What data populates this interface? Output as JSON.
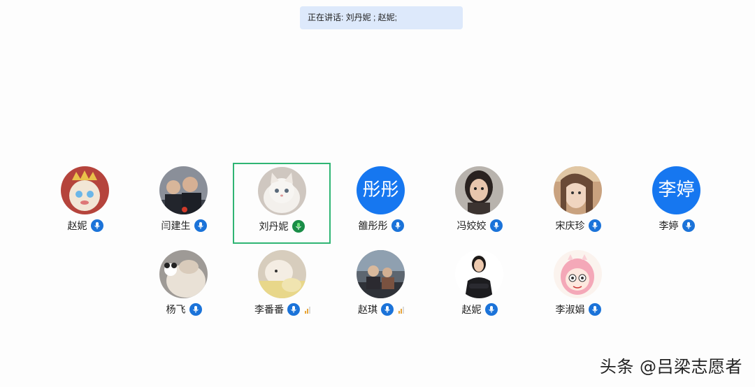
{
  "speaking_bar": {
    "text": "正在讲话: 刘丹妮 ; 赵妮;"
  },
  "participants": [
    {
      "name": "赵妮",
      "avatar": "cat-crown-cartoon",
      "mic_color": "#1b73d9"
    },
    {
      "name": "闫建生",
      "avatar": "men-photo",
      "mic_color": "#1b73d9"
    },
    {
      "name": "刘丹妮",
      "avatar": "white-kitten-photo",
      "mic_color": "#1a8d47",
      "selected": true
    },
    {
      "name": "雒彤彤",
      "avatar_text": "彤彤",
      "mic_color": "#1b73d9"
    },
    {
      "name": "冯姣姣",
      "avatar": "woman-photo",
      "mic_color": "#1b73d9"
    },
    {
      "name": "宋庆珍",
      "avatar": "girl-filter-photo",
      "mic_color": "#1b73d9"
    },
    {
      "name": "李婷",
      "avatar_text": "李婷",
      "mic_color": "#1b73d9"
    },
    {
      "name": "杨飞",
      "avatar": "panda-pillow-photo",
      "mic_color": "#1b73d9"
    },
    {
      "name": "李番番",
      "avatar": "plush-toy-photo",
      "mic_color": "#1b73d9",
      "signal_level": 2
    },
    {
      "name": "赵琪",
      "avatar": "couple-photo",
      "mic_color": "#1b73d9",
      "signal_level": 2
    },
    {
      "name": "赵妮",
      "avatar": "woman-arms-crossed-photo",
      "mic_color": "#1b73d9"
    },
    {
      "name": "李淑娟",
      "avatar": "pink-girl-cartoon",
      "mic_color": "#1b73d9"
    }
  ],
  "watermark": {
    "text": "头条 @吕梁志愿者"
  },
  "icons": {
    "mic": "microphone-icon",
    "signal": "signal-bars-icon"
  }
}
